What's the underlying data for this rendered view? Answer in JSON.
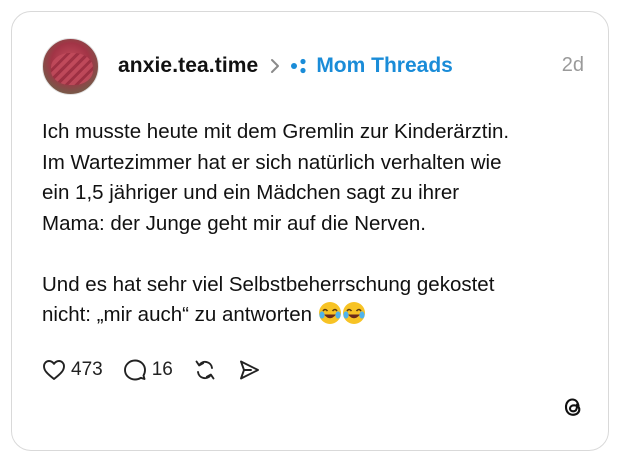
{
  "post": {
    "username": "anxie.tea.time",
    "community": "Mom Threads",
    "time": "2d",
    "paragraphs": [
      "Ich musste heute mit dem Gremlin zur Kinderärztin.",
      "Im Wartezimmer hat er sich natürlich verhalten wie",
      "ein 1,5 jähriger und ein Mädchen sagt zu ihrer",
      "Mama: der Junge geht mir auf die Nerven."
    ],
    "paragraph2_lines": [
      "Und es hat sehr viel Selbstbeherrschung gekostet",
      "nicht: „mir auch“ zu antworten"
    ],
    "emojis": [
      "joy-emoji",
      "joy-emoji"
    ],
    "likes": "473",
    "replies": "16"
  },
  "colors": {
    "accent": "#1a8cd8",
    "border": "#d9d9d9",
    "muted": "#9a9a9a"
  }
}
